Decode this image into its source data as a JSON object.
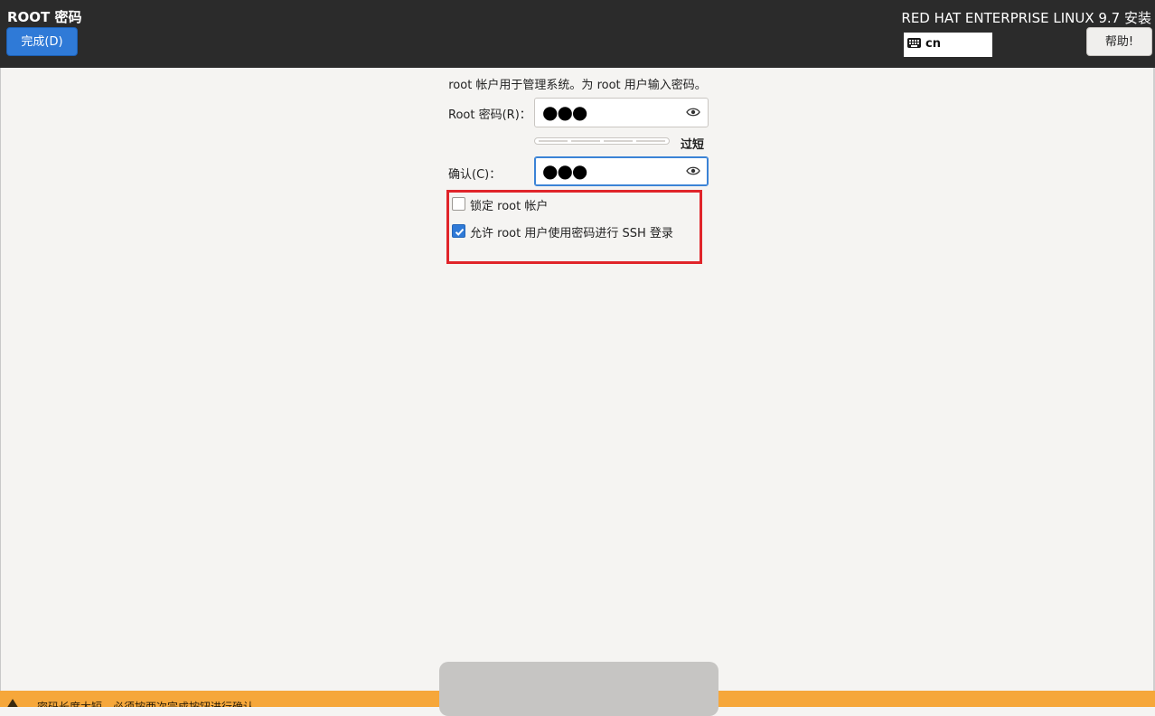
{
  "header": {
    "page_title": "ROOT 密码",
    "done_button": "完成(D)",
    "product_title": "RED HAT ENTERPRISE LINUX 9.7 安装",
    "keyboard_layout": "cn",
    "help_button": "帮助!"
  },
  "form": {
    "description": "root 帐户用于管理系统。为 root 用户输入密码。",
    "root_password_label": "Root 密码(R)：",
    "root_password_value": "●●●",
    "strength_label": "过短",
    "strength_fraction": 0,
    "confirm_label": "确认(C)：",
    "confirm_value": "●●●",
    "lock_root_label": "锁定 root 帐户",
    "lock_root_checked": false,
    "allow_ssh_label": "允许 root 用户使用密码进行 SSH 登录",
    "allow_ssh_checked": true
  },
  "status": {
    "warning_text": "密码长度太短。必须按两次完成按钮进行确认。"
  },
  "colors": {
    "header_bg": "#2b2b2b",
    "accent": "#2f7ad7",
    "highlight": "#e0242a",
    "warning": "#f6a73a"
  }
}
